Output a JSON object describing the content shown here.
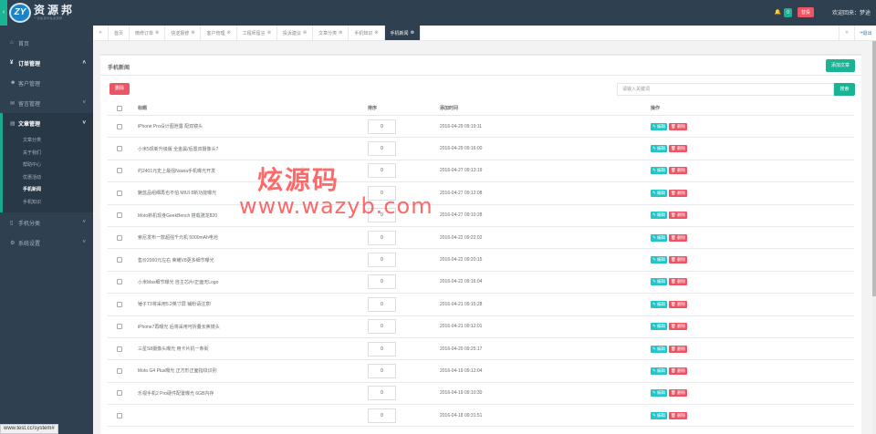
{
  "header": {
    "collapse_icon": "chevron-left-icon",
    "logo_mark": "ZY",
    "logo_title": "资源邦",
    "logo_sub": "一切资源尽在资源邦",
    "notifications": "0",
    "vip_label": "替投",
    "welcome": "欢迎回来：梦途",
    "colors": {
      "bg": "#2f4050",
      "accent": "#1ab394",
      "danger": "#ed5565"
    }
  },
  "sidebar": {
    "items": [
      {
        "icon": "home-icon",
        "label": "首页"
      },
      {
        "icon": "yen-icon",
        "label": "订单管理"
      },
      {
        "icon": "users-icon",
        "label": "客户管理"
      },
      {
        "icon": "comments-icon",
        "label": "留言管理"
      },
      {
        "icon": "document-icon",
        "label": "文章管理"
      },
      {
        "icon": "mobile-icon",
        "label": "手机分类"
      },
      {
        "icon": "gear-icon",
        "label": "系统设置"
      }
    ],
    "submenu": [
      "文章分类",
      "关于我们",
      "帮助中心",
      "优惠活动",
      "手机新闻",
      "手机知识"
    ]
  },
  "tabs": {
    "items": [
      "首页",
      "微修订单",
      "快送报修",
      "客户管理",
      "工程师留言",
      "投诉建议",
      "文章分类",
      "手机知识",
      "手机新闻"
    ],
    "logout": "退出"
  },
  "panel": {
    "title": "手机新闻",
    "add_button": "添加文章",
    "delete_button": "删除",
    "search_placeholder": "请输入关键词",
    "search_button": "搜索"
  },
  "table": {
    "columns": [
      "标题",
      "排序",
      "添加时间",
      "操作"
    ],
    "edit_label": "编辑",
    "remove_label": "删除",
    "rows": [
      {
        "title": "iPhone Pro设计图泄露 配双镜头",
        "sort": "0",
        "date": "2016-04-29 09:19:11"
      },
      {
        "title": "小米5现新升级版 全金属/后置双摄像头?",
        "sort": "0",
        "date": "2016-04-29 09:16:00"
      },
      {
        "title": "约2401元史上最强Nuwia手机曝光开发",
        "sort": "0",
        "date": "2016-04-27 09:13:19"
      },
      {
        "title": "魅蓝品组细再也不怕 MIUI 8新功能曝光",
        "sort": "0",
        "date": "2016-04-27 09:12:08"
      },
      {
        "title": "Moto新机现身GeekBench 搭载骁龙820",
        "sort": "0",
        "date": "2016-04-27 09:10:28"
      },
      {
        "title": "索尼发布一款超强千元机 5000mAh电池",
        "sort": "0",
        "date": "2016-04-22 09:22:02"
      },
      {
        "title": "售价2000元左右 荣耀V8更多细节曝光",
        "sort": "0",
        "date": "2016-04-22 09:20:15"
      },
      {
        "title": "小米Max细节曝光 自主芯片/正面无Logo",
        "sort": "0",
        "date": "2016-04-22 09:16:04"
      },
      {
        "title": "锤子T3将采用5.2英寸屏 铺粉请注意!",
        "sort": "0",
        "date": "2016-04-21 09:15:28"
      },
      {
        "title": "iPhone7再曝光 后将采用可折叠长焦镜头",
        "sort": "0",
        "date": "2016-04-21 09:12:01"
      },
      {
        "title": "三星S8摄像头曝光 用卡片机一条街",
        "sort": "0",
        "date": "2016-04-20 09:25:17"
      },
      {
        "title": "Moto G4 Plus曝光 正方形正面指纹识别",
        "sort": "0",
        "date": "2016-04-19 09:12:04"
      },
      {
        "title": "乐视手机2 Pro硬件配置曝光 6GB内存",
        "sort": "0",
        "date": "2016-04-19 09:10:30"
      },
      {
        "title": "",
        "sort": "0",
        "date": "2016-04-18 09:31:51"
      }
    ]
  },
  "watermark": {
    "line1": "炫源码",
    "line2": "www.wazyb.com"
  },
  "status_url": "www.test.cc/system#"
}
